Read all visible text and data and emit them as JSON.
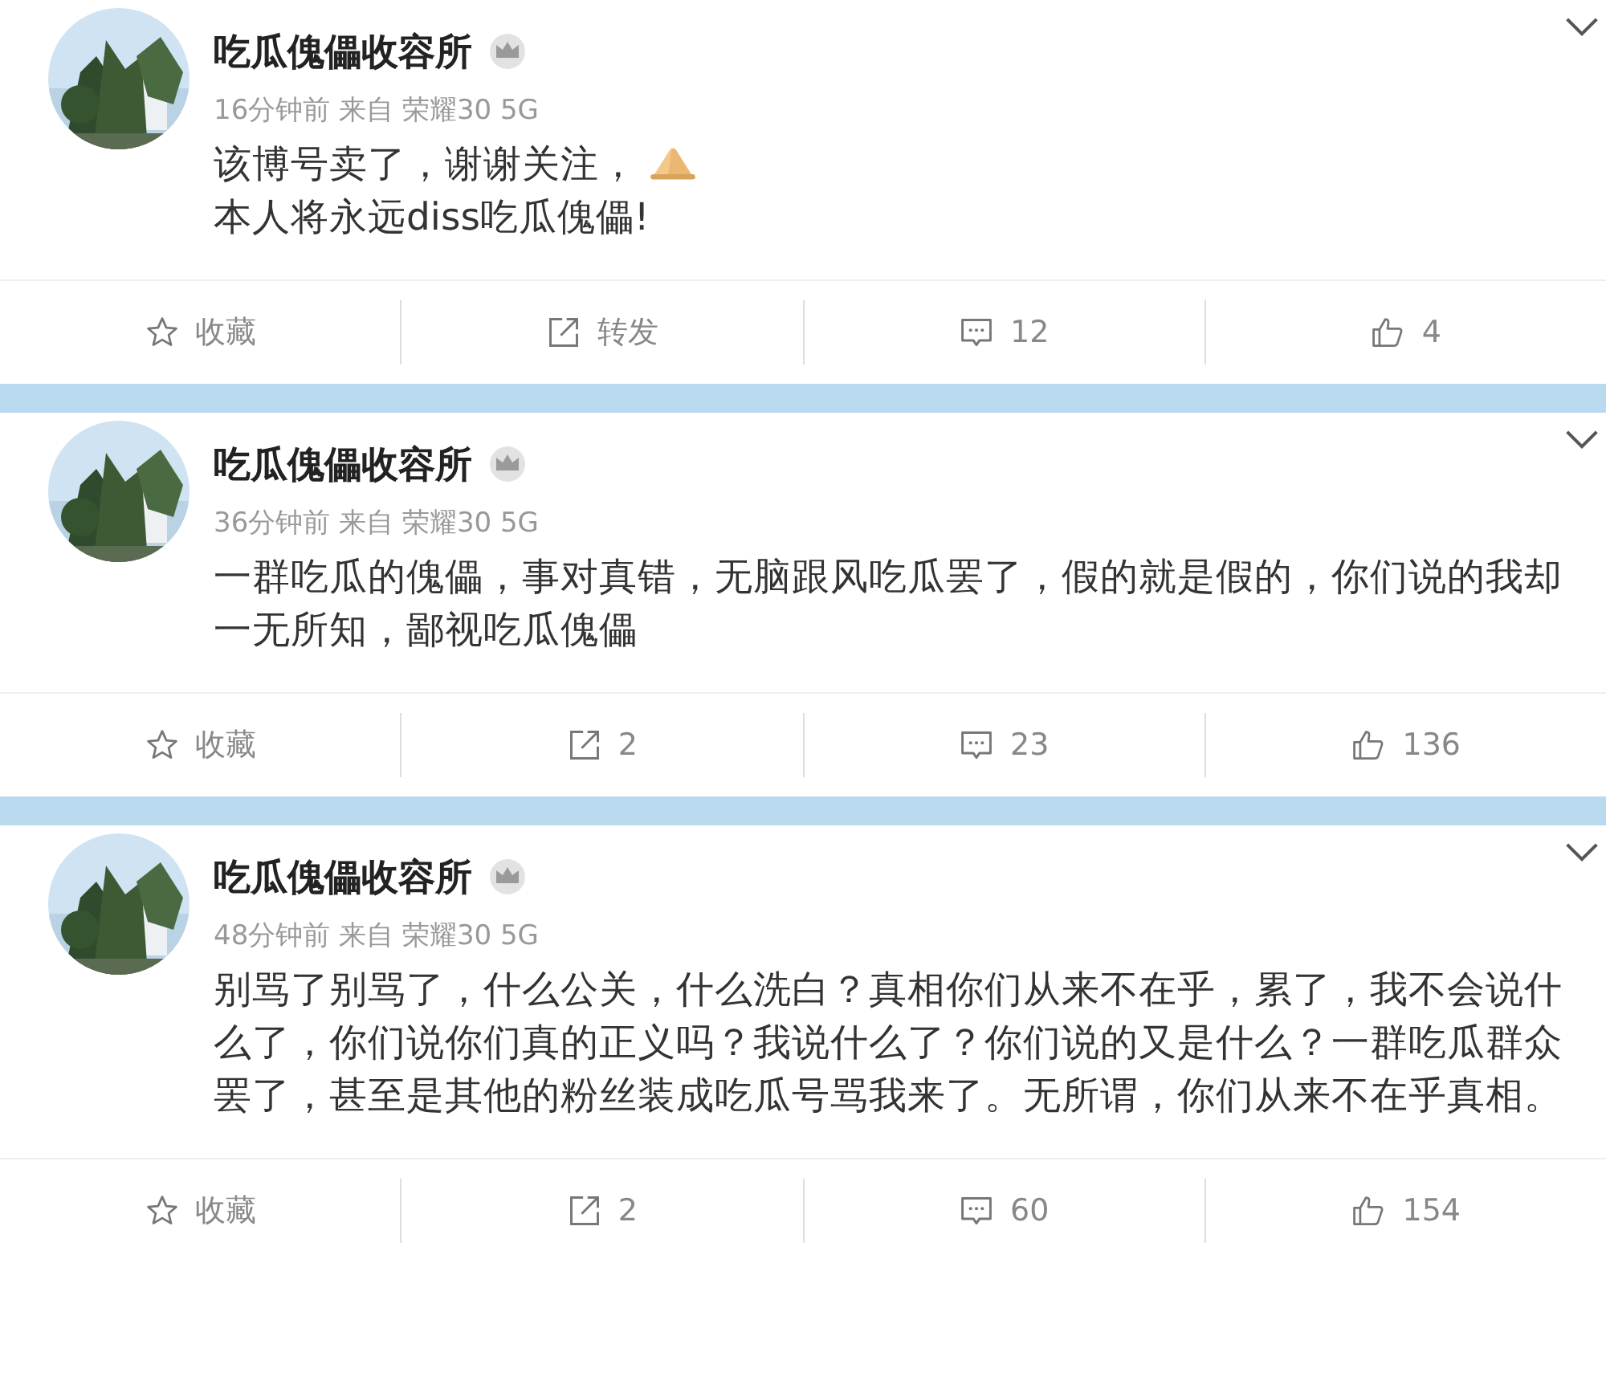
{
  "posts": [
    {
      "user": "吃瓜傀儡收容所",
      "meta": "16分钟前 来自 荣耀30 5G",
      "avatar": {
        "kind": "picture"
      },
      "paragraphs": [
        {
          "text": "该博号卖了，谢谢关注，",
          "emoji": true
        },
        {
          "text": "本人将永远diss吃瓜傀儡!",
          "emoji": false
        }
      ],
      "actions": {
        "favorite": "收藏",
        "repost": "转发",
        "comments": "12",
        "likes": "4"
      }
    },
    {
      "user": "吃瓜傀儡收容所",
      "meta": "36分钟前 来自 荣耀30 5G",
      "avatar": {
        "kind": "picture"
      },
      "paragraphs": [
        {
          "text": "一群吃瓜的傀儡，事对真错，无脑跟风吃瓜罢了，假的就是假的，你们说的我却一无所知，鄙视吃瓜傀儡",
          "emoji": false
        }
      ],
      "actions": {
        "favorite": "收藏",
        "repost": "2",
        "comments": "23",
        "likes": "136"
      }
    },
    {
      "user": "吃瓜傀儡收容所",
      "meta": "48分钟前 来自 荣耀30 5G",
      "avatar": {
        "kind": "picture"
      },
      "paragraphs": [
        {
          "text": "别骂了别骂了，什么公关，什么洗白？真相你们从来不在乎，累了，我不会说什么了，你们说你们真的正义吗？我说什么了？你们说的又是什么？一群吃瓜群众罢了，甚至是其他的粉丝装成吃瓜号骂我来了。无所谓，你们从来不在乎真相。",
          "emoji": false
        }
      ],
      "actions": {
        "favorite": "收藏",
        "repost": "2",
        "comments": "60",
        "likes": "154"
      }
    }
  ]
}
